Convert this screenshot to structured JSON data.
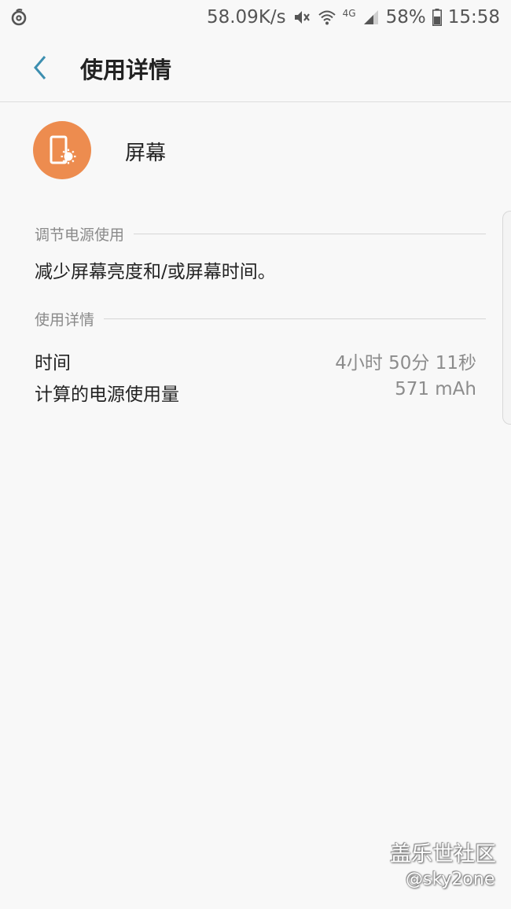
{
  "status_bar": {
    "left_icon": "netease-music-icon",
    "net_speed": "58.09K/s",
    "network_type": "4G",
    "battery": "58%",
    "time": "15:58",
    "icons": [
      "mute-icon",
      "wifi-icon",
      "signal-icon",
      "battery-icon"
    ]
  },
  "app_bar": {
    "title": "使用详情",
    "back_icon": "chevron-left-icon"
  },
  "app": {
    "name": "屏幕",
    "icon": "screen-brightness-icon",
    "icon_color": "#ed8c4f"
  },
  "section_adjust": {
    "title": "调节电源使用",
    "tip": "减少屏幕亮度和/或屏幕时间。"
  },
  "section_details": {
    "title": "使用详情",
    "rows": [
      {
        "label": "时间",
        "value": "4小时 50分 11秒"
      },
      {
        "label": "计算的电源使用量",
        "value": "571 mAh"
      }
    ]
  },
  "watermark": {
    "title": "盖乐世社区",
    "handle": "@sky2one"
  },
  "colors": {
    "accent": "#3d8fb0",
    "background": "#f8f8f8"
  }
}
